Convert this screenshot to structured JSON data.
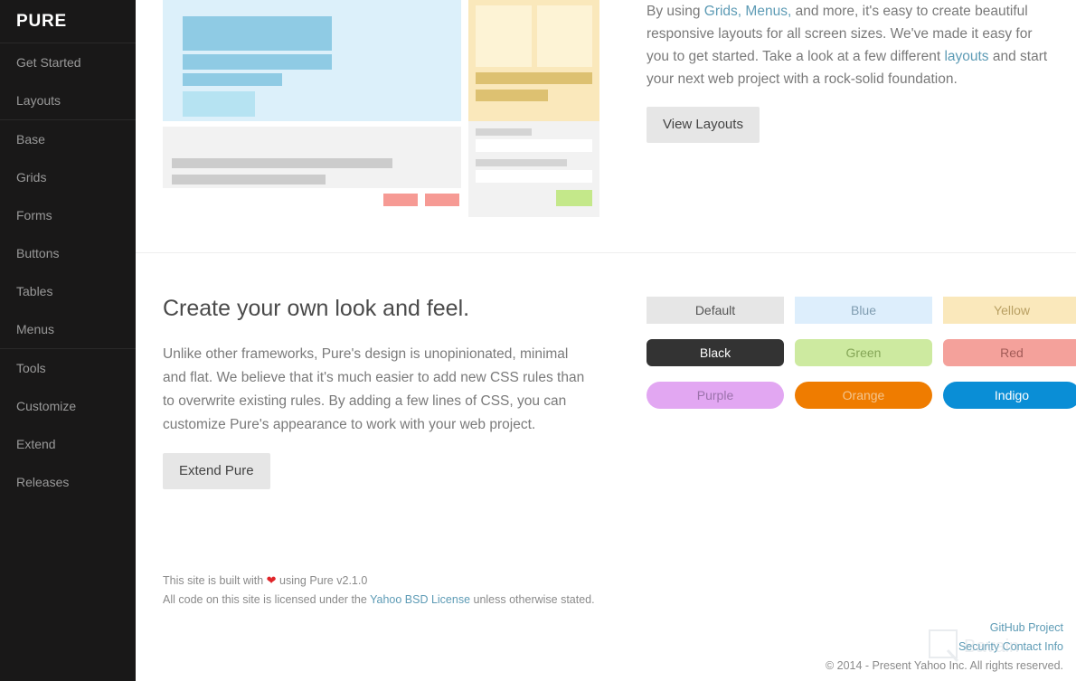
{
  "sidebar": {
    "brand": "PURE",
    "groups": [
      {
        "items": [
          {
            "label": "Get Started",
            "name": "sidebar-item-get-started"
          },
          {
            "label": "Layouts",
            "name": "sidebar-item-layouts"
          }
        ]
      },
      {
        "items": [
          {
            "label": "Base",
            "name": "sidebar-item-base"
          },
          {
            "label": "Grids",
            "name": "sidebar-item-grids"
          },
          {
            "label": "Forms",
            "name": "sidebar-item-forms"
          },
          {
            "label": "Buttons",
            "name": "sidebar-item-buttons"
          },
          {
            "label": "Tables",
            "name": "sidebar-item-tables"
          },
          {
            "label": "Menus",
            "name": "sidebar-item-menus"
          }
        ]
      },
      {
        "items": [
          {
            "label": "Tools",
            "name": "sidebar-item-tools"
          },
          {
            "label": "Customize",
            "name": "sidebar-item-customize"
          },
          {
            "label": "Extend",
            "name": "sidebar-item-extend"
          },
          {
            "label": "Releases",
            "name": "sidebar-item-releases"
          }
        ]
      }
    ]
  },
  "layouts_section": {
    "paragraph": {
      "t1": "By using ",
      "link_grids": "Grids,",
      "t2": " ",
      "link_menus": "Menus,",
      "t3": " and more, it's easy to create beautiful responsive layouts for all screen sizes. We've made it easy for you to get started. Take a look at a few different ",
      "link_layouts": "layouts",
      "t4": " and start your next web project with a rock-solid foundation."
    },
    "button_label": "View Layouts"
  },
  "customize_section": {
    "heading": "Create your own look and feel.",
    "paragraph": "Unlike other frameworks, Pure's design is unopinionated, minimal and flat. We believe that it's much easier to add new CSS rules than to overwrite existing rules. By adding a few lines of CSS, you can customize Pure's appearance to work with your web project.",
    "button_label": "Extend Pure",
    "swatches": [
      {
        "label": "Default",
        "bg": "#e6e6e6",
        "fg": "#555555",
        "radius": "r1"
      },
      {
        "label": "Blue",
        "bg": "#ddeefc",
        "fg": "#7f9cb0",
        "radius": "r1"
      },
      {
        "label": "Yellow",
        "bg": "#fae8bb",
        "fg": "#b9a063",
        "radius": "r1"
      },
      {
        "label": "Black",
        "bg": "#333333",
        "fg": "#ffffff",
        "radius": "r2"
      },
      {
        "label": "Green",
        "bg": "#cdeaa0",
        "fg": "#85a657",
        "radius": "r2"
      },
      {
        "label": "Red",
        "bg": "#f4a19b",
        "fg": "#a25b57",
        "radius": "r2"
      },
      {
        "label": "Purple",
        "bg": "#e2a7f2",
        "fg": "#9b72ab",
        "radius": "r3"
      },
      {
        "label": "Orange",
        "bg": "#ef7c00",
        "fg": "#f4c58c",
        "radius": "r3"
      },
      {
        "label": "Indigo",
        "bg": "#0a8ed6",
        "fg": "#ffffff",
        "radius": "r3"
      }
    ]
  },
  "footer": {
    "built_pre": "This site is built with ",
    "heart": "❤",
    "built_post": " using Pure v2.1.0",
    "license_pre": "All code on this site is licensed under the ",
    "license_link": "Yahoo BSD License",
    "license_post": " unless otherwise stated.",
    "github_link": "GitHub Project",
    "security_link": "Security Contact Info",
    "copyright": "© 2014 - Present Yahoo Inc. All rights reserved."
  }
}
